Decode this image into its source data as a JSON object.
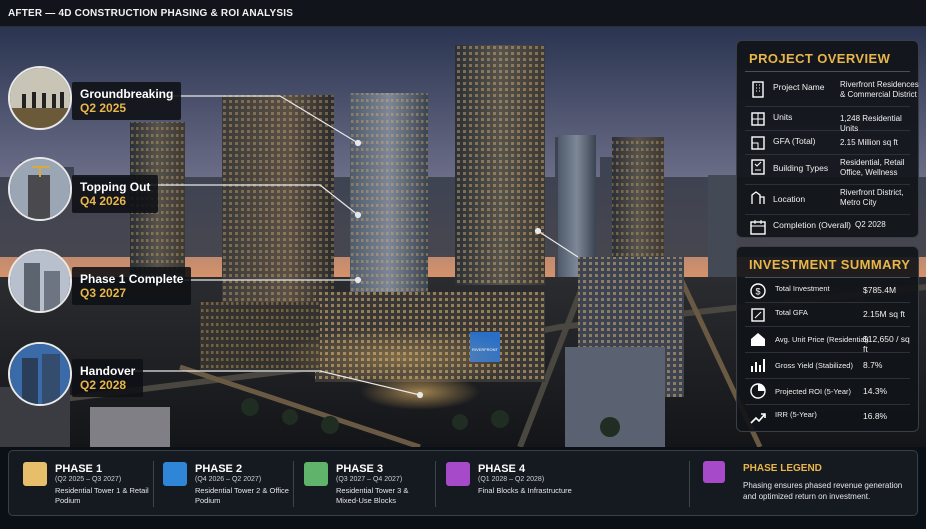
{
  "header": {
    "title": "AFTER — 4D CONSTRUCTION PHASING & ROI ANALYSIS"
  },
  "milestones": [
    {
      "name": "Groundbreaking",
      "date": "Q2 2025"
    },
    {
      "name": "Topping Out",
      "date": "Q4 2026"
    },
    {
      "name": "Phase 1 Complete",
      "date": "Q3 2027"
    },
    {
      "name": "Handover",
      "date": "Q2 2028"
    }
  ],
  "building_sign": "RIVERFRONT",
  "overview": {
    "title": "PROJECT OVERVIEW",
    "rows": [
      {
        "icon": "building-icon",
        "label": "Project Name",
        "value": "Riverfront Residences & Commercial District"
      },
      {
        "icon": "grid-icon",
        "label": "Units",
        "value": "1,248 Residential Units"
      },
      {
        "icon": "floorplan-icon",
        "label": "GFA (Total)",
        "value": "2.15 Million sq ft"
      },
      {
        "icon": "checklist-icon",
        "label": "Building Types",
        "value": "Residential, Retail Office, Wellness"
      },
      {
        "icon": "location-icon",
        "label": "Location",
        "value": "Riverfront District, Metro City"
      },
      {
        "icon": "calendar-icon",
        "label": "Completion (Overall)",
        "value": "Q2 2028"
      }
    ]
  },
  "investment": {
    "title": "INVESTMENT SUMMARY",
    "rows": [
      {
        "icon": "dollar-icon",
        "label": "Total Investment",
        "value": "$785.4M"
      },
      {
        "icon": "area-icon",
        "label": "Total GFA",
        "value": "2.15M sq ft"
      },
      {
        "icon": "house-icon",
        "label": "Avg. Unit Price (Residential)",
        "value": "$12,650 / sq ft"
      },
      {
        "icon": "bar-chart-icon",
        "label": "Gross Yield (Stabilized)",
        "value": "8.7%"
      },
      {
        "icon": "pie-chart-icon",
        "label": "Projected ROI (5-Year)",
        "value": "14.3%"
      },
      {
        "icon": "trend-up-icon",
        "label": "IRR (5-Year)",
        "value": "16.8%"
      }
    ]
  },
  "phases": [
    {
      "name": "PHASE 1",
      "dates": "(Q2 2025 – Q3 2027)",
      "desc": "Residential Tower 1 & Retail Podium",
      "color": "#e7bf6b"
    },
    {
      "name": "PHASE 2",
      "dates": "(Q4 2026 – Q2 2027)",
      "desc": "Residential Tower 2 & Office Podium",
      "color": "#2f86d6"
    },
    {
      "name": "PHASE 3",
      "dates": "(Q3 2027 – Q4 2027)",
      "desc": "Residential Tower 3 & Mixed-Use Blocks",
      "color": "#5fb36a"
    },
    {
      "name": "PHASE 4",
      "dates": "(Q1 2028 – Q2 2028)",
      "desc": "Final Blocks & Infrastructure",
      "color": "#a64ac9"
    }
  ],
  "legend": {
    "title": "PHASE LEGEND",
    "color": "#a64ac9",
    "note": "Phasing ensures phased revenue generation and optimized return on investment."
  }
}
